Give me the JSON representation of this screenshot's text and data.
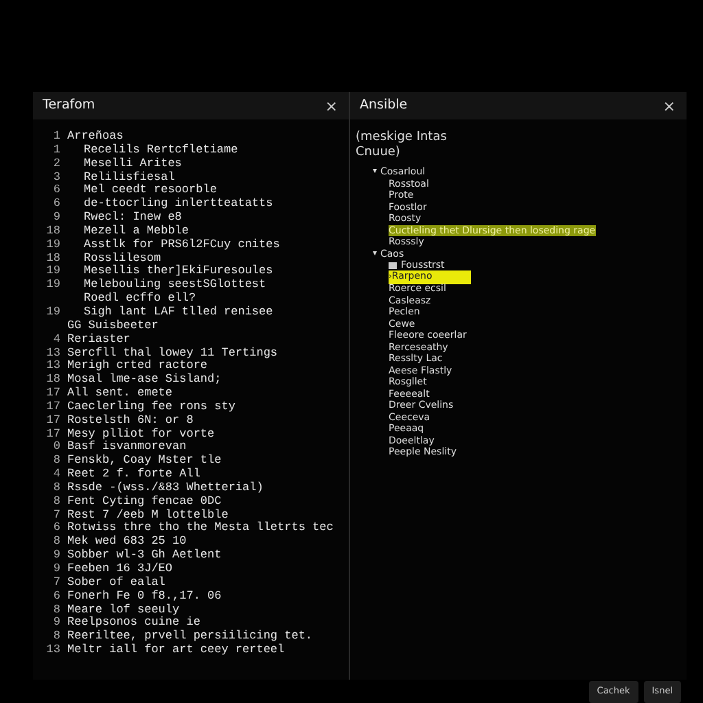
{
  "panels": [
    {
      "title": "Terafom",
      "close": "×"
    },
    {
      "title": "Ansible",
      "close": "×"
    }
  ],
  "code_lines": [
    {
      "number": "1",
      "text": "Arreñoas",
      "indent": false
    },
    {
      "number": "1",
      "text": "Recelils Rertcfletiame",
      "indent": true
    },
    {
      "number": "2",
      "text": "Meselli Arites",
      "indent": true
    },
    {
      "number": "3",
      "text": "Relilisfiesal",
      "indent": true
    },
    {
      "number": "6",
      "text": "Mel ceedt resoorble",
      "indent": true
    },
    {
      "number": "6",
      "text": "de-ttocrling inlertteatatts",
      "indent": true
    },
    {
      "number": "9",
      "text": "Rwecl: Inew e8",
      "indent": true
    },
    {
      "number": "18",
      "text": "Mezell a Mebble",
      "indent": true
    },
    {
      "number": "19",
      "text": "Asstlk for PRS6l2FCuy cnites",
      "indent": true
    },
    {
      "number": "18",
      "text": "Rosslilesom",
      "indent": true
    },
    {
      "number": "19",
      "text": "Mesellis ther]EkiFuresoules",
      "indent": true
    },
    {
      "number": "19",
      "text": "Melebouling seestSGlottest",
      "indent": true
    },
    {
      "text": "Roedl ecffo ell?",
      "indent": true
    },
    {
      "number": "19",
      "text": "Sigh lant LAF tlled renisee",
      "indent": true
    },
    {
      "text": "GG Suisbeeter",
      "indent": false
    },
    {
      "number": "4",
      "text": "Reriaster",
      "indent": false
    },
    {
      "number": "13",
      "text": "Sercfll thal lowey 11 Tertings",
      "indent": false
    },
    {
      "number": "13",
      "text": "Merigh crted ractore",
      "indent": false
    },
    {
      "number": "18",
      "text": "Mosal lme-ase Sisland;",
      "indent": false
    },
    {
      "number": "17",
      "text": "All sent. emete",
      "indent": false
    },
    {
      "number": "17",
      "text": "Caeclerling fee rons sty",
      "indent": false
    },
    {
      "number": "17",
      "text": "Rostelsth 6N: or 8",
      "indent": false
    },
    {
      "number": "17",
      "text": "Mesy plliot for vorte",
      "indent": false
    },
    {
      "number": "0",
      "text": "Basf isvanmorevan",
      "indent": false
    },
    {
      "number": "8",
      "text": "Fenskb, Coay Mster tle",
      "indent": false
    },
    {
      "number": "4",
      "text": "Reet 2 f. forte All",
      "indent": false
    },
    {
      "number": "8",
      "text": "Rssde -(wss./&83 Whetterial)",
      "indent": false
    },
    {
      "number": "8",
      "text": "Fent Cyting fencae 0DC",
      "indent": false
    },
    {
      "number": "7",
      "text": "Rest 7 /eeb M lottelble",
      "indent": false
    },
    {
      "number": "6",
      "text": "Rotwiss thre tho the Mesta lletrts tec",
      "indent": false
    },
    {
      "number": "8",
      "text": "Mek wed 683 25 10",
      "indent": false
    },
    {
      "number": "9",
      "text": "Sobber wl-3 Gh Aetlent",
      "indent": false
    },
    {
      "number": "9",
      "text": "Feeben 16 3J/EO",
      "indent": false
    },
    {
      "number": "7",
      "text": "Sober of ealal",
      "indent": false
    },
    {
      "number": "6",
      "text": "Fonerh Fe 0 f8.,17. 06",
      "indent": false
    },
    {
      "number": "8",
      "text": "Meare lof seeuly",
      "indent": false
    },
    {
      "number": "9",
      "text": "Reelpsonos cuine ie",
      "indent": false
    },
    {
      "number": "8",
      "text": "Reeriltee, prvell persiilicing tet.",
      "indent": false
    },
    {
      "number": "13",
      "text": "Meltr iall for art ceey rerteel",
      "indent": false
    }
  ],
  "tree": {
    "heading": "(meskige Intas Cnuue)",
    "items": [
      {
        "label": "Cosarloul",
        "caret": "▾",
        "expanded": true,
        "selected": false,
        "highlighted": false,
        "children": [
          {
            "label": "Rosstoal",
            "selected": false,
            "highlighted": false
          },
          {
            "label": "Prote",
            "selected": false,
            "highlighted": false
          },
          {
            "label": "Foostlor",
            "selected": false,
            "highlighted": false
          },
          {
            "label": "Roosty",
            "selected": false,
            "highlighted": false
          },
          {
            "label": "Cuctleling thet Dlursige then loseding rage",
            "selected": false,
            "highlighted": true
          },
          {
            "label": "Rosssly",
            "selected": false,
            "highlighted": false
          }
        ]
      },
      {
        "label": "Caos",
        "caret": "▾",
        "expanded": true,
        "selected": false,
        "highlighted": false,
        "children": [
          {
            "label": "Fousstrst",
            "kind": "folder",
            "selected": false,
            "highlighted": false
          },
          {
            "label": "Rarpeno",
            "kind": "collapsed",
            "caret": "›",
            "selected": true,
            "highlighted": false
          },
          {
            "label": "Roerce ecsil",
            "selected": false,
            "highlighted": false
          },
          {
            "label": "Casleasz",
            "selected": false,
            "highlighted": false
          },
          {
            "label": "Peclen",
            "selected": false,
            "highlighted": false
          },
          {
            "label": "Cewe",
            "selected": false,
            "highlighted": false
          },
          {
            "label": "Fleeore coeerlar",
            "selected": false,
            "highlighted": false
          },
          {
            "label": "Rerceseathy",
            "selected": false,
            "highlighted": false
          },
          {
            "label": "Resslty Lac",
            "selected": false,
            "highlighted": false
          },
          {
            "label": "Aeese Flastly",
            "selected": false,
            "highlighted": false
          },
          {
            "label": "Rosgllet",
            "selected": false,
            "highlighted": false
          },
          {
            "label": "Feeeealt",
            "selected": false,
            "highlighted": false
          },
          {
            "label": "Dreer Cvelins",
            "selected": false,
            "highlighted": false
          },
          {
            "label": "Ceeceva",
            "selected": false,
            "highlighted": false
          },
          {
            "label": "Peeaaq",
            "selected": false,
            "highlighted": false
          },
          {
            "label": "Doeeltlay",
            "selected": false,
            "highlighted": false
          },
          {
            "label": "Peeple Neslity",
            "selected": false,
            "highlighted": false
          }
        ]
      }
    ]
  },
  "buttons": [
    "Cachek",
    "Isnel"
  ]
}
